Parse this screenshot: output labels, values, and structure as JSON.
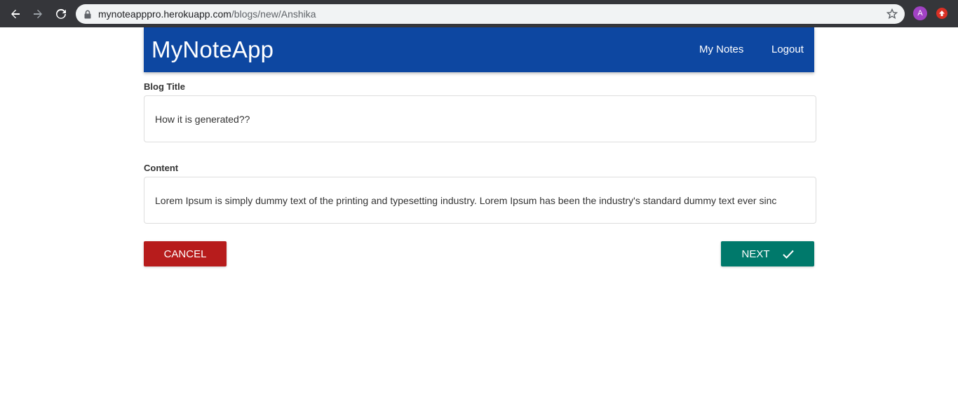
{
  "browser": {
    "url_host": "mynoteapppro.herokuapp.com",
    "url_path": "/blogs/new/Anshika",
    "profile_initial": "A"
  },
  "header": {
    "brand": "MyNoteApp",
    "nav": {
      "my_notes": "My Notes",
      "logout": "Logout"
    },
    "color": "#0d47a1"
  },
  "form": {
    "title_label": "Blog Title",
    "title_value": "How it is generated??",
    "content_label": "Content",
    "content_value": "Lorem Ipsum is simply dummy text of the printing and typesetting industry. Lorem Ipsum has been the industry's standard dummy text ever sinc"
  },
  "actions": {
    "cancel_label": "CANCEL",
    "next_label": "NEXT",
    "cancel_color": "#b71c1c",
    "next_color": "#00796b"
  },
  "icons": {
    "back": "arrow-left-icon",
    "forward": "arrow-right-icon",
    "reload": "reload-icon",
    "lock": "lock-icon",
    "bookmark": "star-icon",
    "next": "check-icon"
  }
}
